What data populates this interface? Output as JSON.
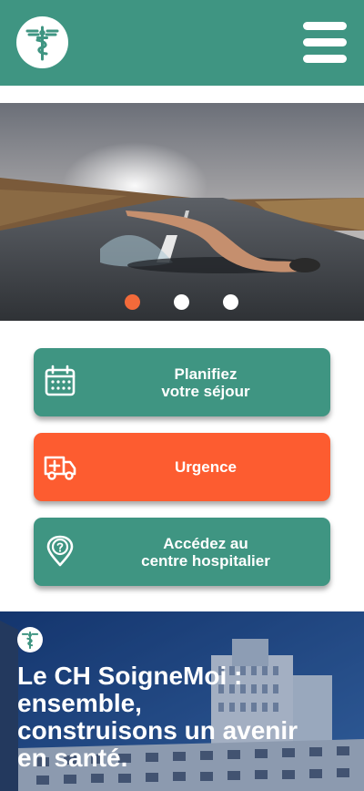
{
  "header": {
    "logo_icon": "caduceus-icon",
    "menu_icon": "hamburger-menu-icon",
    "background": "#3f9582"
  },
  "carousel": {
    "slide_count": 3,
    "active_index": 0,
    "active_color": "#f26a3a"
  },
  "actions": {
    "plan": {
      "line1": "Planifiez",
      "line2": "votre séjour",
      "icon": "calendar-icon",
      "color": "#3f9582"
    },
    "urgence": {
      "label": "Urgence",
      "icon": "ambulance-icon",
      "color": "#fd5c30"
    },
    "access": {
      "line1": "Accédez au",
      "line2": "centre hospitalier",
      "icon": "location-pin-icon",
      "color": "#3f9582"
    }
  },
  "banner": {
    "line1": "Le CH SoigneMoi :",
    "line2": "ensemble,",
    "line3": "construisons un avenir",
    "line4": "en santé."
  }
}
